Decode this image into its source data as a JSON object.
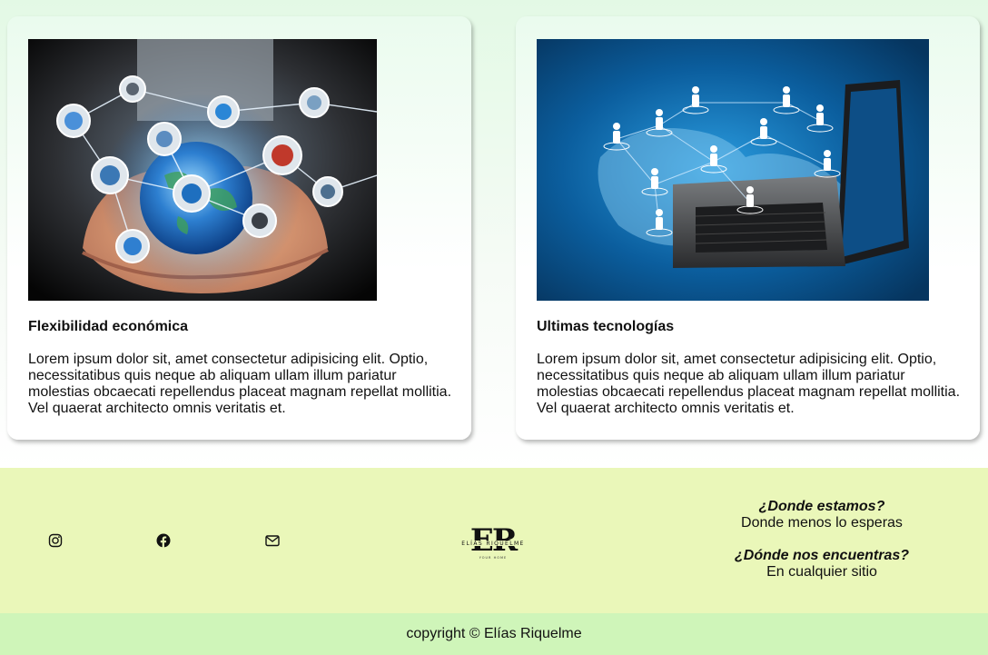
{
  "cards": [
    {
      "title": "Flexibilidad económica",
      "text": "Lorem ipsum dolor sit, amet consectetur adipisicing elit. Optio, necessitatibus quis neque ab aliquam ullam illum pariatur molestias obcaecati repellendus placeat magnam repellat mollitia. Vel quaerat architecto omnis veritatis et."
    },
    {
      "title": "Ultimas tecnologías",
      "text": "Lorem ipsum dolor sit, amet consectetur adipisicing elit. Optio, necessitatibus quis neque ab aliquam ullam illum pariatur molestias obcaecati repellendus placeat magnam repellat mollitia. Vel quaerat architecto omnis veritatis et."
    }
  ],
  "footer": {
    "social": [
      "instagram-icon",
      "facebook-icon",
      "envelope-icon"
    ],
    "logo": {
      "mark": "ER",
      "name": "ELÍAS RIQUELME",
      "tagline": "YOUR HOME"
    },
    "where_question": "¿Donde estamos?",
    "where_answer": "Donde menos lo esperas",
    "find_question": "¿Dónde nos encuentras?",
    "find_answer": "En cualquier sitio",
    "copyright": "copyright © Elías Riquelme"
  },
  "colors": {
    "footer_bg": "#eaf7b9",
    "copyright_bg": "#cff5b9",
    "page_top": "#e3f9e5"
  }
}
